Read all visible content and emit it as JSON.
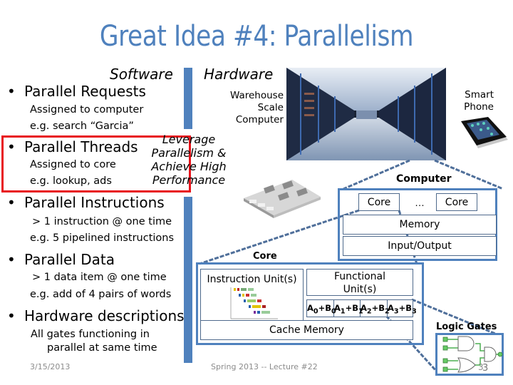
{
  "title": "Great Idea #4: Parallelism",
  "headers": {
    "software": "Software",
    "hardware": "Hardware"
  },
  "software_items": [
    {
      "label": "Parallel Requests",
      "details": [
        "Assigned to computer",
        "e.g. search “Garcia”"
      ]
    },
    {
      "label": "Parallel Threads",
      "details": [
        "Assigned to core",
        "e.g. lookup, ads"
      ]
    },
    {
      "label": "Parallel Instructions",
      "details": [
        "> 1 instruction @ one time",
        "e.g. 5 pipelined instructions"
      ]
    },
    {
      "label": "Parallel Data",
      "details": [
        "> 1 data item @ one time",
        "e.g. add of 4 pairs of words"
      ]
    },
    {
      "label": "Hardware descriptions",
      "details": [
        "All gates functioning in",
        "parallel at same time"
      ]
    }
  ],
  "bullet_glyph": "•",
  "leverage_text": [
    "Leverage",
    "Parallelism &",
    "Achieve High",
    "Performance"
  ],
  "hardware": {
    "warehouse_label": [
      "Warehouse",
      "Scale",
      "Computer"
    ],
    "smartphone_label": [
      "Smart",
      "Phone"
    ],
    "computer": {
      "title": "Computer",
      "core_label": "Core",
      "ellipsis": "…",
      "memory_label": "Memory",
      "io_label": "Input/Output"
    },
    "core": {
      "title": "Core",
      "instruction_unit_label": "Instruction Unit(s)",
      "functional_unit_label": [
        "Functional",
        "Unit(s)"
      ],
      "sums": [
        {
          "a": "A",
          "ai": "0",
          "b": "B",
          "bi": "0"
        },
        {
          "a": "A",
          "ai": "1",
          "b": "B",
          "bi": "1"
        },
        {
          "a": "A",
          "ai": "2",
          "b": "B",
          "bi": "2"
        },
        {
          "a": "A",
          "ai": "3",
          "b": "B",
          "bi": "3"
        }
      ],
      "cache_label": "Cache Memory"
    },
    "logic_gates": {
      "title": "Logic Gates",
      "number": "3"
    }
  },
  "footer": {
    "date": "3/15/2013",
    "course": "Spring 2013 -- Lecture #22",
    "page": "3"
  },
  "colors": {
    "accent": "#4f81bd",
    "highlight": "#e8141b",
    "footer_text": "#8c8c8c"
  }
}
